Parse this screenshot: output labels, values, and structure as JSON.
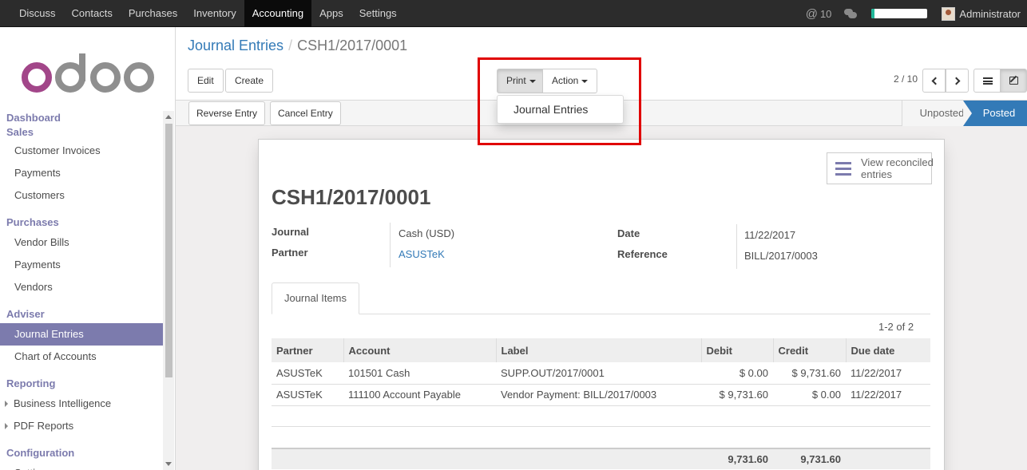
{
  "topnav": {
    "menu": [
      "Discuss",
      "Contacts",
      "Purchases",
      "Inventory",
      "Accounting",
      "Apps",
      "Settings"
    ],
    "active": "Accounting",
    "mentions": "10",
    "user": "Administrator",
    "progress_fraction": 0.05
  },
  "sidebar": {
    "logo": "odoo",
    "sections": [
      {
        "header": "Dashboard",
        "items": []
      },
      {
        "header": "Sales",
        "items": [
          "Customer Invoices",
          "Payments",
          "Customers"
        ]
      },
      {
        "header": "Purchases",
        "items": [
          "Vendor Bills",
          "Payments",
          "Vendors"
        ]
      },
      {
        "header": "Adviser",
        "items": [
          "Journal Entries",
          "Chart of Accounts"
        ]
      },
      {
        "header": "Reporting",
        "items": [
          "Business Intelligence",
          "PDF Reports"
        ]
      },
      {
        "header": "Configuration",
        "items": [
          "Settings"
        ]
      }
    ],
    "active_item": "Journal Entries"
  },
  "control_panel": {
    "breadcrumb_parent": "Journal Entries",
    "breadcrumb_current": "CSH1/2017/0001",
    "edit_label": "Edit",
    "create_label": "Create",
    "print_label": "Print",
    "action_label": "Action",
    "pager": "2 / 10"
  },
  "print_dropdown": {
    "items": [
      "Journal Entries"
    ]
  },
  "statusbar": {
    "reverse_label": "Reverse Entry",
    "cancel_label": "Cancel Entry",
    "stages": [
      "Unposted",
      "Posted"
    ],
    "current_stage": "Posted"
  },
  "form": {
    "reconcile_label": "View reconciled entries",
    "title": "CSH1/2017/0001",
    "journal_label": "Journal",
    "journal_value": "Cash (USD)",
    "partner_label": "Partner",
    "partner_value": "ASUSTeK",
    "date_label": "Date",
    "date_value": "11/22/2017",
    "reference_label": "Reference",
    "reference_value": "BILL/2017/0003",
    "tab_label": "Journal Items",
    "record_count": "1-2 of 2"
  },
  "journal_items": {
    "columns": [
      "Partner",
      "Account",
      "Label",
      "Debit",
      "Credit",
      "Due date"
    ],
    "rows": [
      [
        "ASUSTeK",
        "101501 Cash",
        "SUPP.OUT/2017/0001",
        "$ 0.00",
        "$ 9,731.60",
        "11/22/2017"
      ],
      [
        "ASUSTeK",
        "111100 Account Payable",
        "Vendor Payment: BILL/2017/0003",
        "$ 9,731.60",
        "$ 0.00",
        "11/22/2017"
      ]
    ],
    "total_debit": "9,731.60",
    "total_credit": "9,731.60"
  },
  "colors": {
    "topnav_bg": "#2c2c2c",
    "brand_purple": "#7c7bad",
    "link_blue": "#337ab7",
    "highlight_red": "#e00000"
  }
}
